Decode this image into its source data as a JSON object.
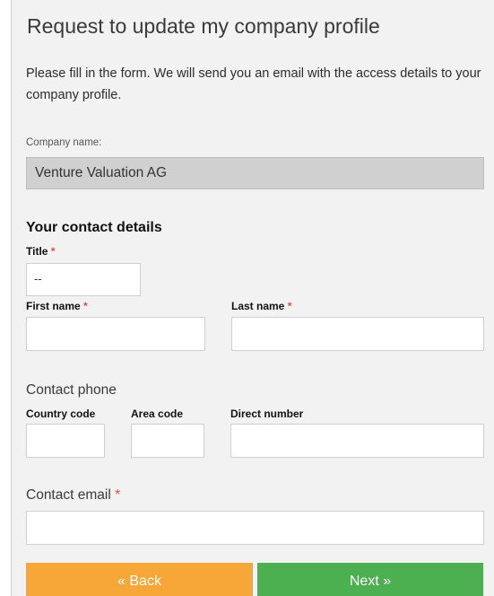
{
  "page": {
    "title": "Request to update my company profile",
    "intro": "Please fill in the form. We will send you an email with the access details to your company profile."
  },
  "company": {
    "label": "Company name:",
    "value": "Venture Valuation AG"
  },
  "contact": {
    "section_title": "Your contact details",
    "title_label": "Title",
    "title_value": "--",
    "first_name_label": "First name",
    "last_name_label": "Last name",
    "required_mark": "*"
  },
  "phone": {
    "group_title": "Contact phone",
    "country_code_label": "Country code",
    "area_code_label": "Area code",
    "direct_number_label": "Direct number"
  },
  "email": {
    "group_title": "Contact email",
    "required_mark": "*"
  },
  "buttons": {
    "back_label": "« Back",
    "next_label": "Next »"
  },
  "colors": {
    "back_button": "#f7a738",
    "next_button": "#4caf50",
    "required": "#e74c3c"
  }
}
